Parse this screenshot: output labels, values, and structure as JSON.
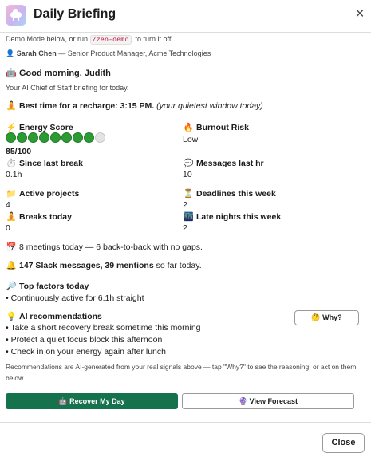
{
  "header": {
    "title": "Daily Briefing",
    "close_icon": "close-icon",
    "app_icon": "cloud-app-icon"
  },
  "demo": {
    "prefix": "Demo Mode below, or run",
    "command": "/zen-demo",
    "suffix": ", to turn it off."
  },
  "user": {
    "icon": "👤",
    "name": "Sarah Chen",
    "role": " — Senior Product Manager, Acme Technologies"
  },
  "greeting": {
    "icon": "🤖",
    "title": "Good morning, Judith",
    "subtitle": "Your AI Chief of Staff briefing for today."
  },
  "recharge": {
    "icon": "🧘",
    "label": "Best time for a recharge: 3:15 PM.",
    "note": "(your quietest window today)"
  },
  "metrics": {
    "energy": {
      "icon": "⚡",
      "label": "Energy Score",
      "value": "85/100",
      "score": 85,
      "dots_filled": 8,
      "dots_total": 9
    },
    "burnout": {
      "icon": "🔥",
      "label": "Burnout Risk",
      "value": "Low"
    },
    "since_break": {
      "icon": "⏱️",
      "label": "Since last break",
      "value": "0.1h"
    },
    "messages_hr": {
      "icon": "💬",
      "label": "Messages last hr",
      "value": "10"
    },
    "projects": {
      "icon": "📁",
      "label": "Active projects",
      "value": "4"
    },
    "deadlines": {
      "icon": "⏳",
      "label": "Deadlines this week",
      "value": "2"
    },
    "breaks": {
      "icon": "🧘",
      "label": "Breaks today",
      "value": "0"
    },
    "late_nights": {
      "icon": "🌃",
      "label": "Late nights this week",
      "value": "2"
    }
  },
  "meetings": {
    "icon": "📅",
    "text": "8 meetings today — 6 back-to-back with no gaps."
  },
  "slack": {
    "icon": "🔔",
    "bold": "147 Slack messages, 39 mentions",
    "rest": " so far today."
  },
  "factors": {
    "icon": "🔎",
    "title": "Top factors today",
    "items": [
      "• Continuously active for 6.1h straight"
    ]
  },
  "recommendations": {
    "icon": "💡",
    "title": "AI recommendations",
    "why_button": "🤔 Why?",
    "items": [
      "• Take a short recovery break sometime this morning",
      "• Protect a quiet focus block this afternoon",
      "• Check in on your energy again after lunch"
    ],
    "disclaimer_line1": "Recommendations are AI-generated from your real signals above — tap \"Why?\" to see the reasoning, or act on them",
    "disclaimer_line2": "below."
  },
  "actions": {
    "recover": "🤖 Recover My Day",
    "forecast": "🔮 View Forecast"
  },
  "footer": {
    "close": "Close"
  },
  "colors": {
    "primary": "#15724d",
    "energy_dot": "#2d9b34",
    "code": "#c01343"
  }
}
